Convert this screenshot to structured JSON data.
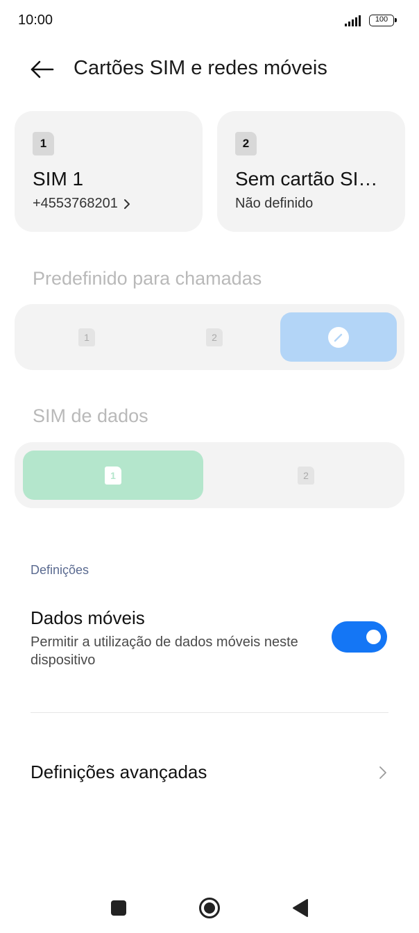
{
  "status_bar": {
    "time": "10:00",
    "battery": "100"
  },
  "header": {
    "title": "Cartões SIM e redes móveis"
  },
  "sim_cards": [
    {
      "slot": "1",
      "name": "SIM 1",
      "subtitle": "+4553768201"
    },
    {
      "slot": "2",
      "name": "Sem cartão SI…",
      "subtitle": "Não definido"
    }
  ],
  "calls_default": {
    "label": "Predefinido para chamadas",
    "options": [
      "1",
      "2"
    ],
    "selected_color": "#b3d5f7"
  },
  "data_sim": {
    "label": "SIM de dados",
    "options": [
      "1",
      "2"
    ],
    "selected_color": "#b4e6cc"
  },
  "settings": {
    "section_label": "Definições",
    "mobile_data": {
      "title": "Dados móveis",
      "description": "Permitir a utilização de dados móveis neste dispositivo",
      "enabled": true,
      "toggle_color": "#1476f5"
    },
    "advanced": {
      "title": "Definições avançadas"
    }
  }
}
